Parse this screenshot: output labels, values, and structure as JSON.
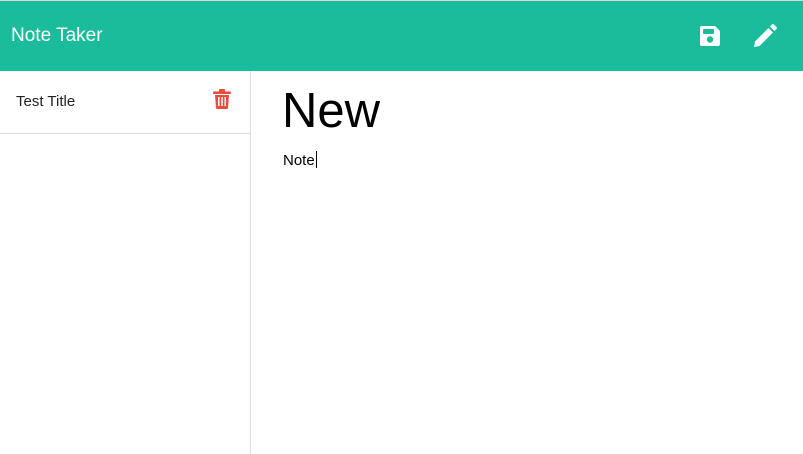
{
  "header": {
    "title": "Note Taker",
    "background_color": "#1abc9c",
    "save_icon": "floppy-disk-icon",
    "new_icon": "pencil-icon"
  },
  "sidebar": {
    "notes": [
      {
        "title": "Test Title",
        "delete_icon": "trash-icon",
        "delete_color": "#e74c3c"
      }
    ]
  },
  "editor": {
    "title_value": "New",
    "body_value": "Note"
  }
}
